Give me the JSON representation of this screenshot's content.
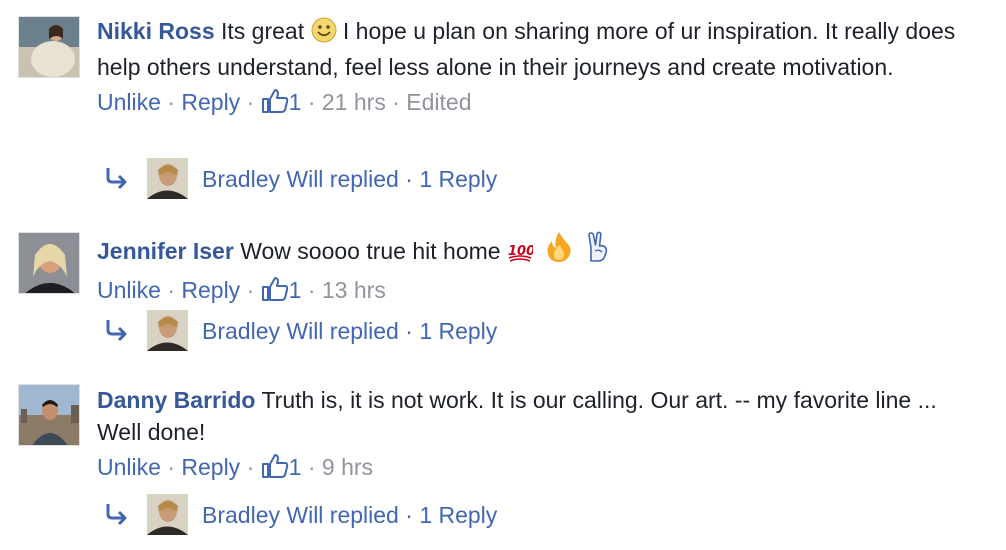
{
  "comments": [
    {
      "author": "Nikki Ross",
      "text_before": "Its great",
      "emoji_1": "smile-emoji",
      "text_after": "I hope u plan on sharing more of ur inspiration. It really does help others understand, feel less alone in their journeys and create motivation.",
      "unlike": "Unlike",
      "reply": "Reply",
      "likes": "1",
      "time": "21 hrs",
      "edited": "Edited",
      "replies": {
        "summary": "Bradley Will replied",
        "count": "1 Reply"
      }
    },
    {
      "author": "Jennifer Iser",
      "text_before": "Wow soooo true hit home",
      "emojis": [
        "hundred-points-emoji",
        "fire-emoji",
        "victory-hand-emoji"
      ],
      "unlike": "Unlike",
      "reply": "Reply",
      "likes": "1",
      "time": "13 hrs",
      "replies": {
        "summary": "Bradley Will replied",
        "count": "1 Reply"
      }
    },
    {
      "author": "Danny Barrido",
      "text_before": "Truth is, it is not work. It is our calling. Our art. -- my favorite line ... Well done!",
      "unlike": "Unlike",
      "reply": "Reply",
      "likes": "1",
      "time": "9 hrs",
      "replies": {
        "summary": "Bradley Will replied",
        "count": "1 Reply"
      }
    }
  ],
  "separator": "·",
  "colors": {
    "link": "#4267b2",
    "author": "#365899",
    "meta": "#90949c",
    "text": "#1d2129"
  }
}
